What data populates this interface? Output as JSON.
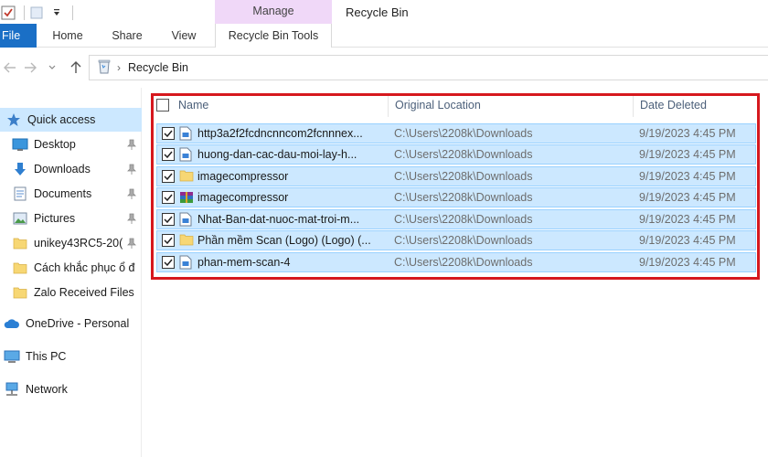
{
  "window": {
    "title": "Recycle Bin",
    "context_tab_group": "Manage"
  },
  "ribbon": {
    "tabs": [
      {
        "label": "File"
      },
      {
        "label": "Home"
      },
      {
        "label": "Share"
      },
      {
        "label": "View"
      },
      {
        "label": "Recycle Bin Tools"
      }
    ]
  },
  "address": {
    "path": "Recycle Bin"
  },
  "sidebar": {
    "items": [
      {
        "label": "Quick access",
        "icon": "star-icon"
      },
      {
        "label": "Desktop",
        "icon": "desktop-icon"
      },
      {
        "label": "Downloads",
        "icon": "download-arrow-icon"
      },
      {
        "label": "Documents",
        "icon": "document-icon"
      },
      {
        "label": "Pictures",
        "icon": "pictures-icon"
      },
      {
        "label": "unikey43RC5-20(",
        "icon": "folder-icon"
      },
      {
        "label": "Cách khắc phục ổ đ",
        "icon": "folder-icon"
      },
      {
        "label": "Zalo Received Files",
        "icon": "folder-icon"
      },
      {
        "label": "OneDrive - Personal",
        "icon": "cloud-icon"
      },
      {
        "label": "This PC",
        "icon": "computer-icon"
      },
      {
        "label": "Network",
        "icon": "network-icon"
      }
    ]
  },
  "columns": {
    "name": "Name",
    "location": "Original Location",
    "date": "Date Deleted"
  },
  "files": [
    {
      "name": "http3a2f2fcdncnncom2fcnnnex...",
      "location": "C:\\Users\\2208k\\Downloads",
      "date": "9/19/2023 4:45 PM",
      "icon": "image-file-icon"
    },
    {
      "name": "huong-dan-cac-dau-moi-lay-h...",
      "location": "C:\\Users\\2208k\\Downloads",
      "date": "9/19/2023 4:45 PM",
      "icon": "image-file-icon"
    },
    {
      "name": "imagecompressor",
      "location": "C:\\Users\\2208k\\Downloads",
      "date": "9/19/2023 4:45 PM",
      "icon": "folder-icon"
    },
    {
      "name": "imagecompressor",
      "location": "C:\\Users\\2208k\\Downloads",
      "date": "9/19/2023 4:45 PM",
      "icon": "archive-icon"
    },
    {
      "name": "Nhat-Ban-dat-nuoc-mat-troi-m...",
      "location": "C:\\Users\\2208k\\Downloads",
      "date": "9/19/2023 4:45 PM",
      "icon": "image-file-icon"
    },
    {
      "name": "Phần mềm Scan (Logo) (Logo) (...",
      "location": "C:\\Users\\2208k\\Downloads",
      "date": "9/19/2023 4:45 PM",
      "icon": "folder-icon"
    },
    {
      "name": "phan-mem-scan-4",
      "location": "C:\\Users\\2208k\\Downloads",
      "date": "9/19/2023 4:45 PM",
      "icon": "image-file-icon"
    }
  ],
  "colors": {
    "file_tab": "#1a6fc6",
    "context_tab": "#f0d8f8",
    "selection": "#cce8ff",
    "highlight_border": "#d6181e"
  }
}
